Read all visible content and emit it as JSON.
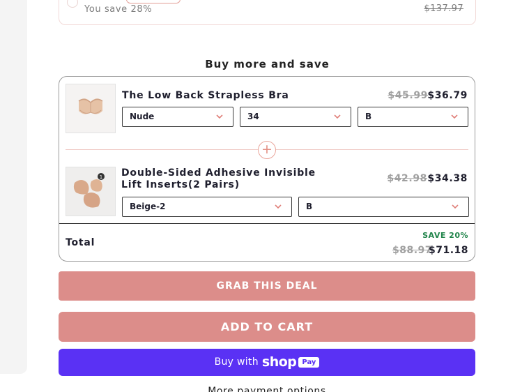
{
  "left_panel": {},
  "previous_offer": {
    "savings_text": "You save 28%",
    "original_price": "$137.97"
  },
  "bundle": {
    "title": "Buy more and save",
    "items": [
      {
        "name": "The Low Back Strapless Bra",
        "original_price": "$45.99",
        "sale_price": "$36.79",
        "options": [
          "Nude",
          "34",
          "B"
        ]
      },
      {
        "name": "Double-Sided Adhesive Invisible Lift Inserts(2 Pairs)",
        "original_price": "$42.98",
        "sale_price": "$34.38",
        "options": [
          "Beige-2",
          "B"
        ]
      }
    ],
    "plus_symbol": "+",
    "total_label": "Total",
    "save_badge": "SAVE 20%",
    "total_original": "$88.97",
    "total_sale": "$71.18"
  },
  "buttons": {
    "grab_deal": "GRAB THIS DEAL",
    "add_to_cart": "ADD TO CART",
    "buy_with": "Buy with",
    "shop_logo": "shop",
    "pay_pill": "Pay",
    "more_options": "More payment options"
  },
  "colors": {
    "accent_pink": "#dc8d8a",
    "shop_purple": "#5a31f4",
    "save_green": "#20844a"
  }
}
